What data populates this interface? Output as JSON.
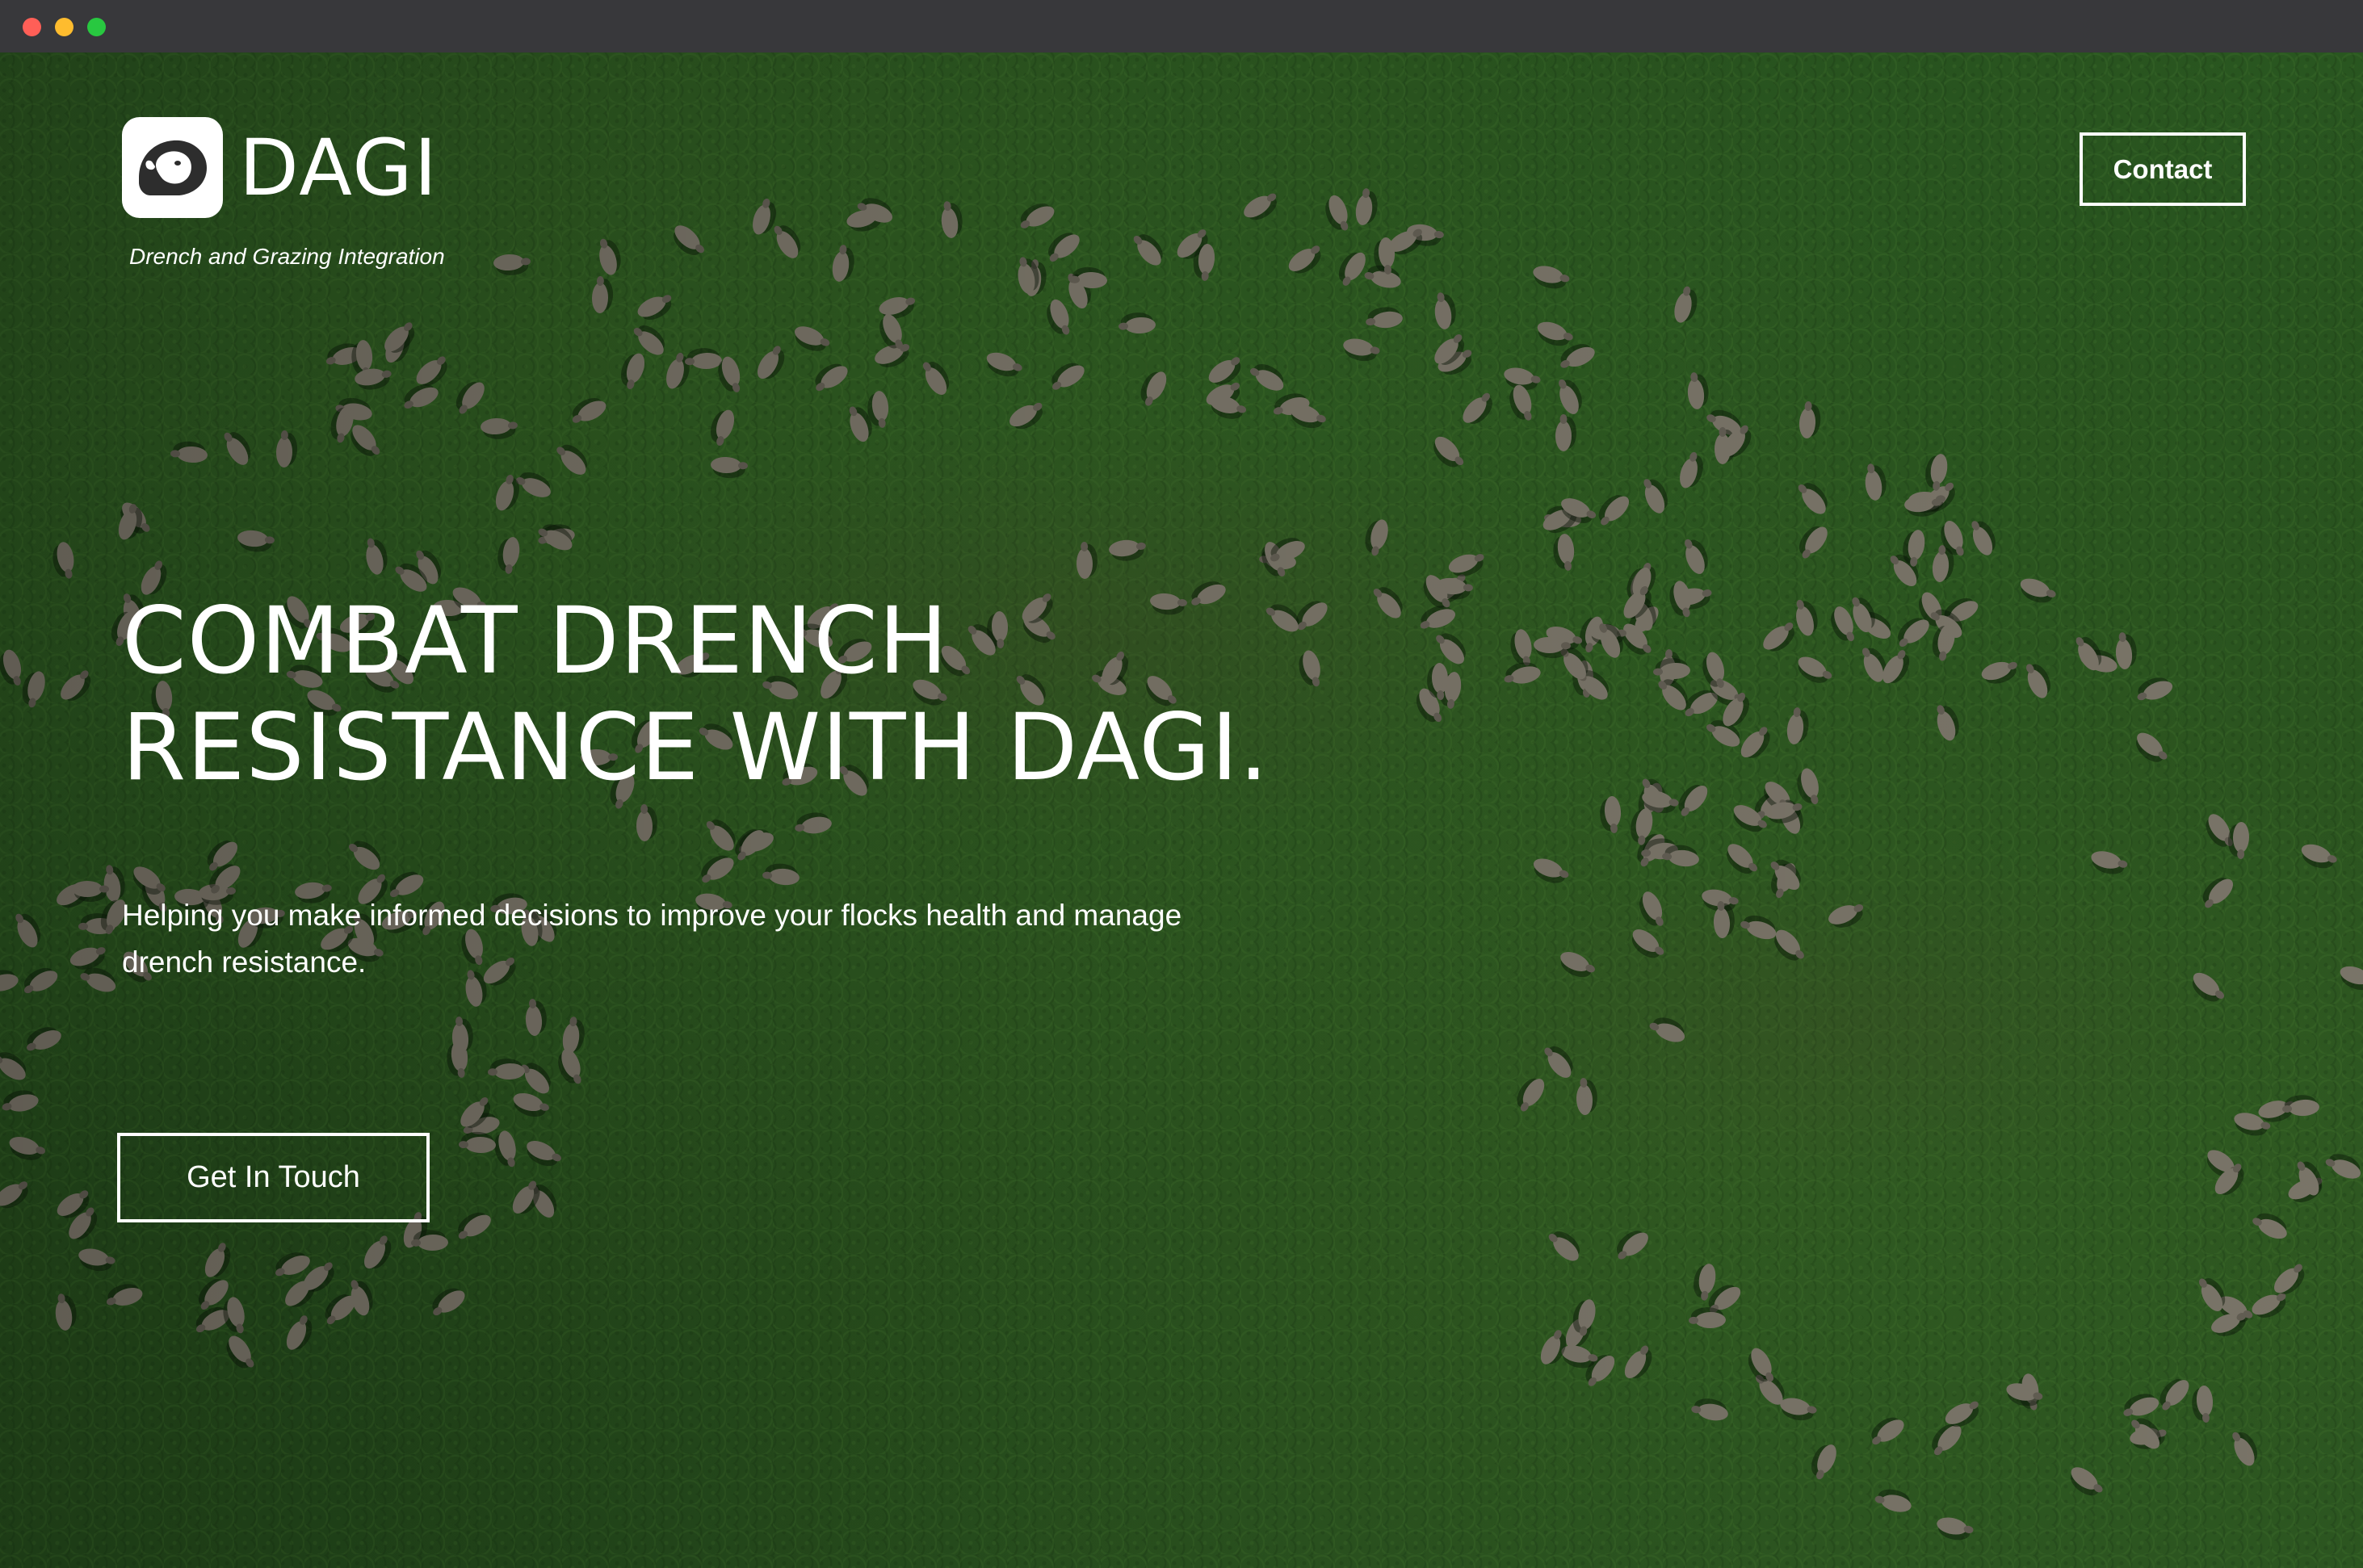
{
  "window": {
    "controls": [
      "close",
      "minimize",
      "zoom"
    ]
  },
  "header": {
    "brand": "DAGI",
    "tagline": "Drench and Grazing Integration",
    "logo_icon": "sheep-head-icon",
    "contact_label": "Contact"
  },
  "hero": {
    "headline_line1": "COMBAT DRENCH",
    "headline_line2": "RESISTANCE WITH DAGI.",
    "subtext": "Helping you make informed decisions to improve your flocks health and manage drench resistance.",
    "cta_label": "Get In Touch",
    "background": "aerial photo of sheep grazing on green pasture"
  },
  "colors": {
    "text": "#ffffff",
    "grass": "#2f6224",
    "sheep": "#8a8476"
  }
}
